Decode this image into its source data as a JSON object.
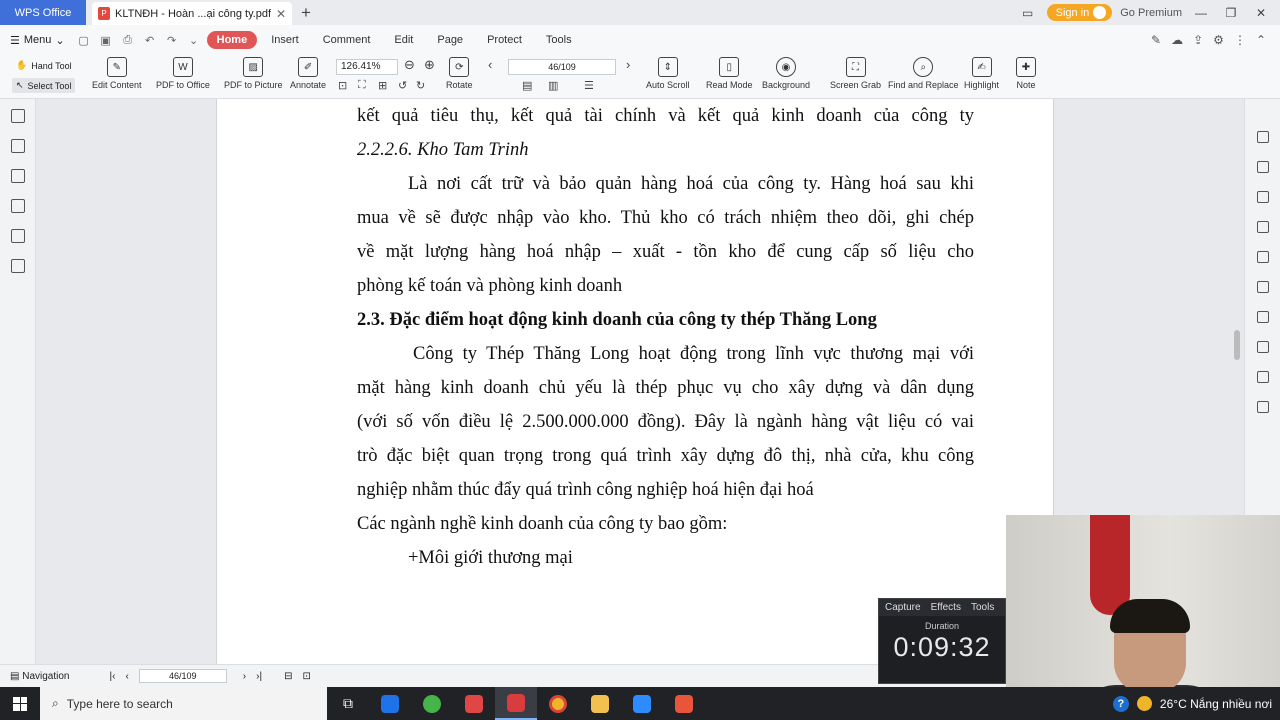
{
  "tabs": {
    "app_tab": "WPS Office",
    "doc_tab": "KLTNĐH - Hoàn ...ại công ty.pdf",
    "sign_in": "Sign in",
    "premium": "Go Premium"
  },
  "menu": {
    "menu_label": "Menu",
    "tabs": [
      "Home",
      "Insert",
      "Comment",
      "Edit",
      "Page",
      "Protect",
      "Tools"
    ]
  },
  "ribbon": {
    "hand_tool": "Hand Tool",
    "select_tool": "Select Tool",
    "edit_content": "Edit Content",
    "pdf_to_office": "PDF to Office",
    "pdf_to_picture": "PDF to Picture",
    "annotate": "Annotate",
    "zoom": "126.41%",
    "rotate": "Rotate",
    "page_indicator": "46/109",
    "auto_scroll": "Auto Scroll",
    "read_mode": "Read Mode",
    "background": "Background",
    "screen_grab": "Screen Grab",
    "find_replace": "Find and Replace",
    "highlight": "Highlight",
    "note": "Note"
  },
  "document": {
    "lines": [
      "kết quả tiêu thụ, kết quả tài chính và kết quả kinh doanh của công ty",
      "2.2.2.6. Kho Tam Trinh",
      "Là nơi cất trữ và bảo quản hàng hoá của công ty. Hàng hoá sau khi",
      "mua về sẽ được nhập vào kho. Thủ kho có trách nhiệm theo dõi, ghi chép",
      "về mặt lượng hàng hoá nhập – xuất - tồn kho để cung cấp số liệu cho",
      "phòng kế toán và phòng kinh doanh",
      "2.3. Đặc điểm hoạt động kinh doanh của công ty thép Thăng Long",
      "Công ty Thép Thăng Long hoạt động trong lĩnh vực thương mại với",
      "mặt hàng kinh doanh chủ yếu là thép phục vụ cho xây dựng và dân dụng",
      "(với số vốn điều lệ 2.500.000.000 đồng). Đây là ngành hàng vật liệu có vai",
      "trò đặc biệt quan trọng trong quá trình xây dựng đô thị, nhà cửa, khu công",
      "nghiệp nhằm thúc đẩy quá trình công nghiệp hoá hiện đại hoá",
      "Các ngành nghề kinh doanh của công ty  bao gồm:",
      "+Môi giới thương mại"
    ]
  },
  "statusbar": {
    "navigation": "Navigation",
    "page": "46/109"
  },
  "recorder": {
    "tabs": [
      "Capture",
      "Effects",
      "Tools"
    ],
    "duration_label": "Duration",
    "time": "0:09:32"
  },
  "taskbar": {
    "search_placeholder": "Type here to search",
    "weather": "26°C  Nắng nhiều nơi"
  }
}
